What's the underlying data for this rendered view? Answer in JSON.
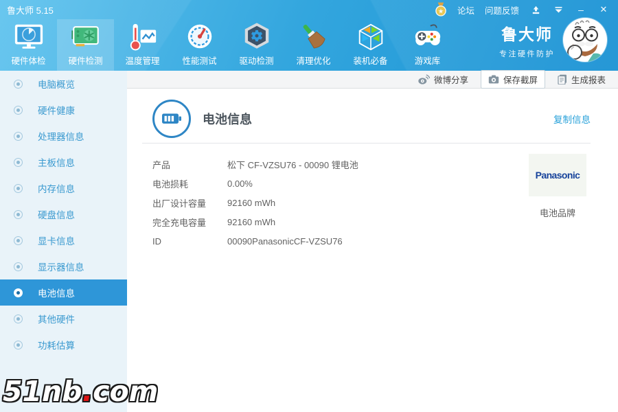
{
  "window": {
    "title": "鲁大师 5.15"
  },
  "titlebar": {
    "forum": "论坛",
    "feedback": "问题反馈",
    "medal_icon": "medal-icon",
    "update_icon": "update-download-icon",
    "skin_icon": "caret-down-icon",
    "minimize_glyph": "–",
    "close_glyph": "✕"
  },
  "toolbar": {
    "tabs": [
      {
        "label": "硬件体检",
        "icon": "monitor-radar-icon",
        "active": false
      },
      {
        "label": "硬件检测",
        "icon": "gpu-card-icon",
        "active": true
      },
      {
        "label": "温度管理",
        "icon": "thermometer-chart-icon",
        "active": false
      },
      {
        "label": "性能测试",
        "icon": "gauge-icon",
        "active": false
      },
      {
        "label": "驱动检测",
        "icon": "gear-hexagon-icon",
        "active": false
      },
      {
        "label": "清理优化",
        "icon": "brush-icon",
        "active": false
      },
      {
        "label": "装机必备",
        "icon": "cube-icon",
        "active": false
      },
      {
        "label": "游戏库",
        "icon": "gamepad-icon",
        "active": false
      }
    ],
    "brand": {
      "name": "鲁大师",
      "slogan": "专注硬件防护",
      "mascot_icon": "mascot-avatar"
    }
  },
  "actionbar": {
    "items": [
      {
        "label": "微博分享",
        "icon": "weibo-icon"
      },
      {
        "label": "保存截屏",
        "icon": "camera-icon"
      },
      {
        "label": "生成报表",
        "icon": "report-icon"
      }
    ]
  },
  "sidebar": {
    "items": [
      {
        "label": "电脑概览",
        "active": false
      },
      {
        "label": "硬件健康",
        "active": false
      },
      {
        "label": "处理器信息",
        "active": false
      },
      {
        "label": "主板信息",
        "active": false
      },
      {
        "label": "内存信息",
        "active": false
      },
      {
        "label": "硬盘信息",
        "active": false
      },
      {
        "label": "显卡信息",
        "active": false
      },
      {
        "label": "显示器信息",
        "active": false
      },
      {
        "label": "电池信息",
        "active": true
      },
      {
        "label": "其他硬件",
        "active": false
      },
      {
        "label": "功耗估算",
        "active": false
      }
    ]
  },
  "content": {
    "title": "电池信息",
    "title_icon": "battery-icon",
    "copy_link": "复制信息",
    "rows": [
      {
        "label": "产品",
        "value": "松下 CF-VZSU76 - 00090 锂电池"
      },
      {
        "label": "电池损耗",
        "value": "0.00%"
      },
      {
        "label": "出厂设计容量",
        "value": "92160 mWh"
      },
      {
        "label": "完全充电容量",
        "value": "92160 mWh"
      },
      {
        "label": "ID",
        "value": "00090PanasonicCF-VZSU76"
      }
    ],
    "brand_box": {
      "logo_text": "Panasonic",
      "caption": "电池品牌"
    }
  },
  "watermark": {
    "part1": "51nb",
    "dot": ".",
    "part2": "com"
  },
  "colors": {
    "accent": "#2e96d8",
    "header_gradient_start": "#60c3ee",
    "header_gradient_end": "#1a92d4",
    "sidebar_bg": "#e9f3f9",
    "sidebar_text": "#3b9ad0",
    "link": "#2aa2da",
    "panasonic_blue": "#17439b",
    "watermark_dot": "#e01515"
  }
}
